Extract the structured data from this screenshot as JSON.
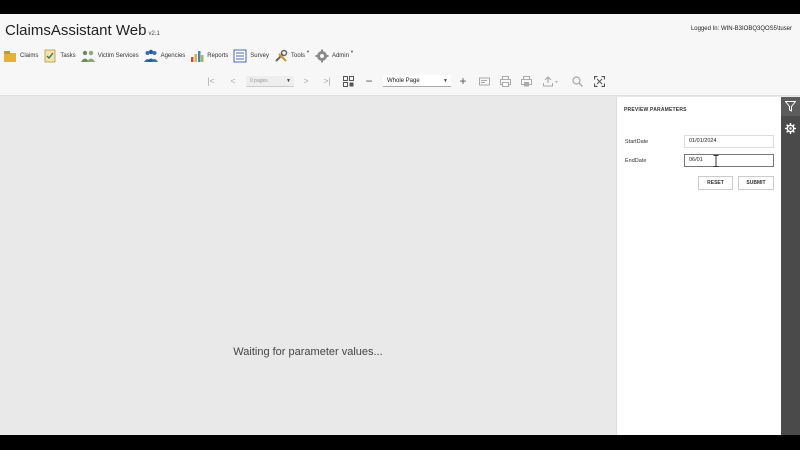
{
  "header": {
    "title": "ClaimsAssistant Web",
    "version": "v2.1",
    "logged_in": "Logged In: WIN-B3IOBQ3QOS5\\tuser"
  },
  "nav": {
    "items": [
      {
        "label": "Claims",
        "icon": "claims-icon",
        "color": "#e3b23c"
      },
      {
        "label": "Tasks",
        "icon": "tasks-icon",
        "color": "#d9a93a"
      },
      {
        "label": "Victim Services",
        "icon": "victim-services-icon",
        "color": "#6b8e5a"
      },
      {
        "label": "Agencies",
        "icon": "agencies-icon",
        "color": "#3a6fb5"
      },
      {
        "label": "Reports",
        "icon": "reports-icon",
        "color": "#c0504d"
      },
      {
        "label": "Survey",
        "icon": "survey-icon",
        "color": "#4a6ea8"
      },
      {
        "label": "Tools",
        "icon": "tools-icon",
        "color": "#7a7a7a"
      },
      {
        "label": "Admin",
        "icon": "admin-icon",
        "color": "#7a7a7a"
      }
    ]
  },
  "toolbar": {
    "pages_placeholder": "0 pages",
    "zoom_value": "Whole Page"
  },
  "viewer": {
    "waiting_text": "Waiting for parameter values..."
  },
  "params": {
    "title": "PREVIEW PARAMETERS",
    "start_label": "StartDate",
    "start_value": "01/01/2024",
    "end_label": "EndDate",
    "end_value": "06/01",
    "reset_label": "RESET",
    "submit_label": "SUBMIT"
  },
  "rail": {
    "items": [
      "filter-icon",
      "gear-icon"
    ]
  }
}
